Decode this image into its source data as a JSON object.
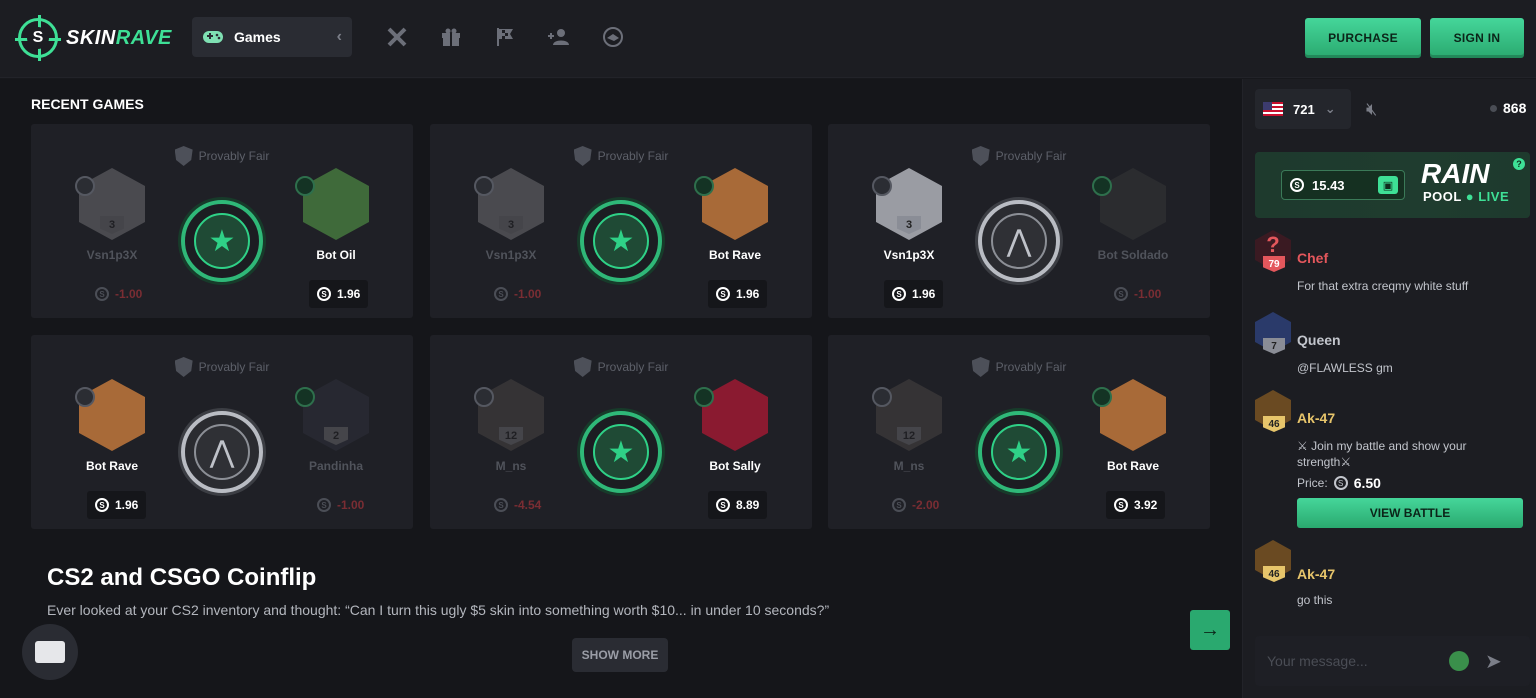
{
  "brand": {
    "name_part1": "SKIN",
    "name_part2": "RAVE",
    "mark": "S"
  },
  "nav": {
    "games_label": "Games",
    "icons": [
      "swords-icon",
      "gift-icon",
      "race-flag-icon",
      "add-user-icon",
      "handshake-icon"
    ]
  },
  "header": {
    "purchase_label": "PURCHASE",
    "signin_label": "SIGN IN"
  },
  "recent": {
    "title": "RECENT GAMES",
    "provably_fair": "Provably Fair",
    "games": [
      {
        "left": {
          "name": "Vsn1p3X",
          "level": "3",
          "amount": "-1.00"
        },
        "right": {
          "name": "Bot Oil",
          "amount": "1.96"
        },
        "winner": "right",
        "coin": "green"
      },
      {
        "left": {
          "name": "Vsn1p3X",
          "level": "3",
          "amount": "-1.00"
        },
        "right": {
          "name": "Bot Rave",
          "amount": "1.96"
        },
        "winner": "right",
        "coin": "green"
      },
      {
        "left": {
          "name": "Vsn1p3X",
          "level": "3",
          "amount": "1.96"
        },
        "right": {
          "name": "Bot Soldado",
          "amount": "-1.00"
        },
        "winner": "left",
        "coin": "silver"
      },
      {
        "left": {
          "name": "Bot Rave",
          "level": "",
          "amount": "1.96"
        },
        "right": {
          "name": "Pandinha",
          "level": "2",
          "amount": "-1.00"
        },
        "winner": "left",
        "coin": "silver"
      },
      {
        "left": {
          "name": "M_ns",
          "level": "12",
          "amount": "-4.54"
        },
        "right": {
          "name": "Bot Sally",
          "amount": "8.89"
        },
        "winner": "right",
        "coin": "green"
      },
      {
        "left": {
          "name": "M_ns",
          "level": "12",
          "amount": "-2.00"
        },
        "right": {
          "name": "Bot Rave",
          "amount": "3.92"
        },
        "winner": "right",
        "coin": "green"
      }
    ]
  },
  "coinflip": {
    "title": "CS2 and CSGO Coinflip",
    "desc": "Ever looked at your CS2 inventory and thought: “Can I turn this ugly $5 skin into something worth $10... in under 10 seconds?”",
    "show_more": "SHOW MORE"
  },
  "sidebar": {
    "region_count": "721",
    "online_count": "868",
    "rain": {
      "amount": "15.43",
      "title": "RAIN",
      "pool": "POOL",
      "live": "LIVE",
      "help": "?"
    },
    "messages": [
      {
        "name": "Chef",
        "level": "79",
        "text": "For that extra creqmy white stuff",
        "name_color": "#e4575c"
      },
      {
        "name": "Queen",
        "level": "7",
        "text": "@FLAWLESS gm",
        "name_color": "#c2c5cc"
      },
      {
        "name": "Ak-47",
        "level": "46",
        "text": "⚔ Join my battle and show your strength⚔",
        "price_label": "Price:",
        "price": "6.50",
        "button": "VIEW BATTLE",
        "name_color": "#e7c56b"
      },
      {
        "name": "Ak-47",
        "level": "46",
        "text": "go this",
        "name_color": "#e7c56b"
      }
    ],
    "input_placeholder": "Your message..."
  },
  "colors": {
    "accent": "#3ee096",
    "bg": "#17181c",
    "card": "#1f2026",
    "loss": "#7a2d33"
  }
}
